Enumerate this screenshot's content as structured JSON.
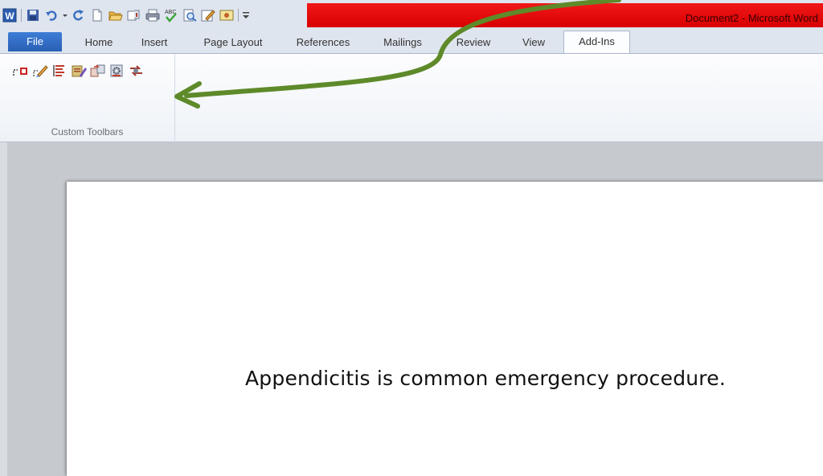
{
  "window": {
    "title": "Document2 - Microsoft Word"
  },
  "quick_access": {
    "icons": [
      "word-app-icon",
      "save-icon",
      "undo-icon",
      "undo-dropdown-icon",
      "redo-icon",
      "new-document-icon",
      "open-icon",
      "attach-icon",
      "print-icon",
      "spelling-icon",
      "print-preview-icon",
      "edit-icon",
      "picture-icon",
      "customize-dropdown-icon"
    ]
  },
  "ribbon": {
    "tabs": [
      "File",
      "Home",
      "Insert",
      "Page Layout",
      "References",
      "Mailings",
      "Review",
      "View",
      "Add-Ins"
    ],
    "active_tab": "Add-Ins",
    "groups": [
      {
        "label": "Custom Toolbars",
        "icons": [
          "link-field-icon",
          "brush-edit-icon",
          "list-format-icon",
          "pencil-note-icon",
          "sync-icon",
          "gear-doc-icon",
          "swap-arrows-icon"
        ]
      }
    ]
  },
  "document": {
    "text": "Appendicitis is common emergency procedure."
  },
  "colors": {
    "title_bar_accent": "#e00000",
    "file_tab": "#2f67c0",
    "annotation_arrow": "#5e8a2a"
  }
}
